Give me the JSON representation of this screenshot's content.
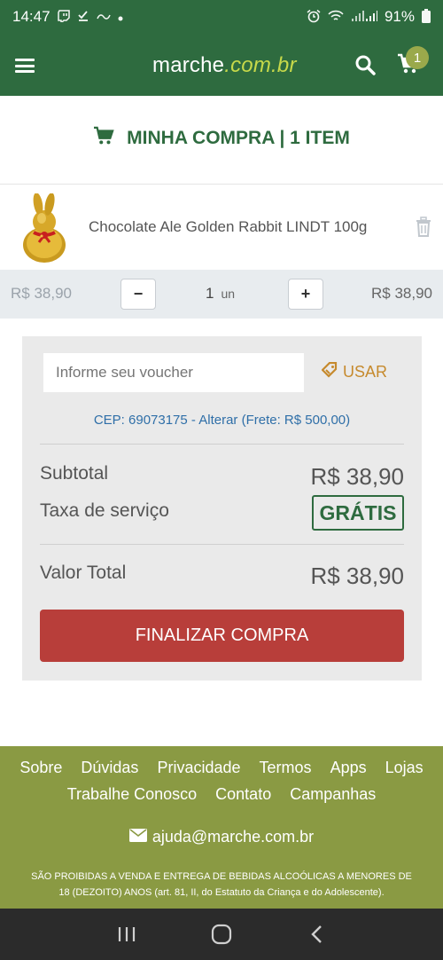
{
  "status_bar": {
    "time": "14:47",
    "battery": "91%",
    "icons": [
      "twitch-icon",
      "check-icon",
      "app-icon",
      "dot-icon",
      "alarm-icon",
      "wifi-icon",
      "signal-icon",
      "battery-icon"
    ]
  },
  "header": {
    "logo_main": "marche",
    "logo_tld": ".com.br",
    "cart_badge": "1",
    "colors": {
      "bar": "#2e6b3f",
      "accent": "#c7d94a"
    }
  },
  "page": {
    "title": "MINHA COMPRA | 1 ITEM"
  },
  "cart_item": {
    "name": "Chocolate Ale Golden Rabbit LINDT 100g",
    "unit_price": "R$ 38,90",
    "quantity": "1",
    "unit": "un",
    "minus_label": "−",
    "plus_label": "+",
    "line_total": "R$ 38,90"
  },
  "summary": {
    "voucher_placeholder": "Informe seu voucher",
    "voucher_button": "USAR",
    "cep_text": "CEP: 69073175 - Alterar (Frete: R$ 500,00)",
    "subtotal_label": "Subtotal",
    "subtotal_value": "R$ 38,90",
    "service_fee_label": "Taxa de serviço",
    "service_fee_value": "GRÁTIS",
    "total_label": "Valor Total",
    "total_value": "R$ 38,90",
    "checkout_button": "FINALIZAR COMPRA"
  },
  "footer": {
    "links_row1": [
      "Sobre",
      "Dúvidas",
      "Privacidade",
      "Termos",
      "Apps",
      "Lojas"
    ],
    "links_row2": [
      "Trabalhe Conosco",
      "Contato",
      "Campanhas"
    ],
    "email": "ajuda@marche.com.br",
    "legal_caps": "SÃO PROIBIDAS A VENDA E ENTREGA DE BEBIDAS ALCOÓLICAS A MENORES DE 18 (DEZOITO) ANOS",
    "legal_ref": "(art. 81, II, do Estatuto da Criança e do Adolescente)."
  }
}
